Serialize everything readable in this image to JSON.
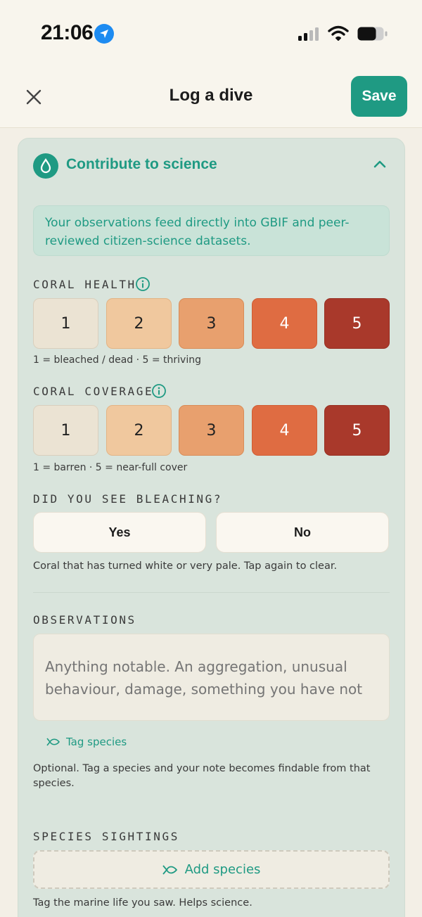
{
  "status": {
    "time": "21:06"
  },
  "header": {
    "title": "Log a dive",
    "save_label": "Save"
  },
  "section": {
    "title": "Contribute to science",
    "info": "Your observations feed directly into GBIF and peer-reviewed citizen-science datasets."
  },
  "coral_health": {
    "label": "CORAL HEALTH",
    "options": [
      "1",
      "2",
      "3",
      "4",
      "5"
    ],
    "hint": "1 = bleached / dead · 5 = thriving"
  },
  "coral_coverage": {
    "label": "CORAL COVERAGE",
    "options": [
      "1",
      "2",
      "3",
      "4",
      "5"
    ],
    "hint": "1 = barren · 5 = near-full cover"
  },
  "bleaching": {
    "label": "DID YOU SEE BLEACHING?",
    "yes": "Yes",
    "no": "No",
    "hint": "Coral that has turned white or very pale. Tap again to clear."
  },
  "observations": {
    "label": "OBSERVATIONS",
    "placeholder": "Anything notable. An aggregation, unusual behaviour, damage, something you have not",
    "tag_label": "Tag species",
    "helper": "Optional. Tag a species and your note becomes findable from that species."
  },
  "species": {
    "label": "SPECIES SIGHTINGS",
    "add_label": "Add species",
    "helper": "Tag the marine life you saw. Helps science."
  },
  "colors": {
    "accent": "#1f9a83",
    "card_bg": "#d9e4dc",
    "rating": [
      "#ebe3d3",
      "#f0c89e",
      "#e8a06e",
      "#df6c42",
      "#a9392b"
    ]
  }
}
